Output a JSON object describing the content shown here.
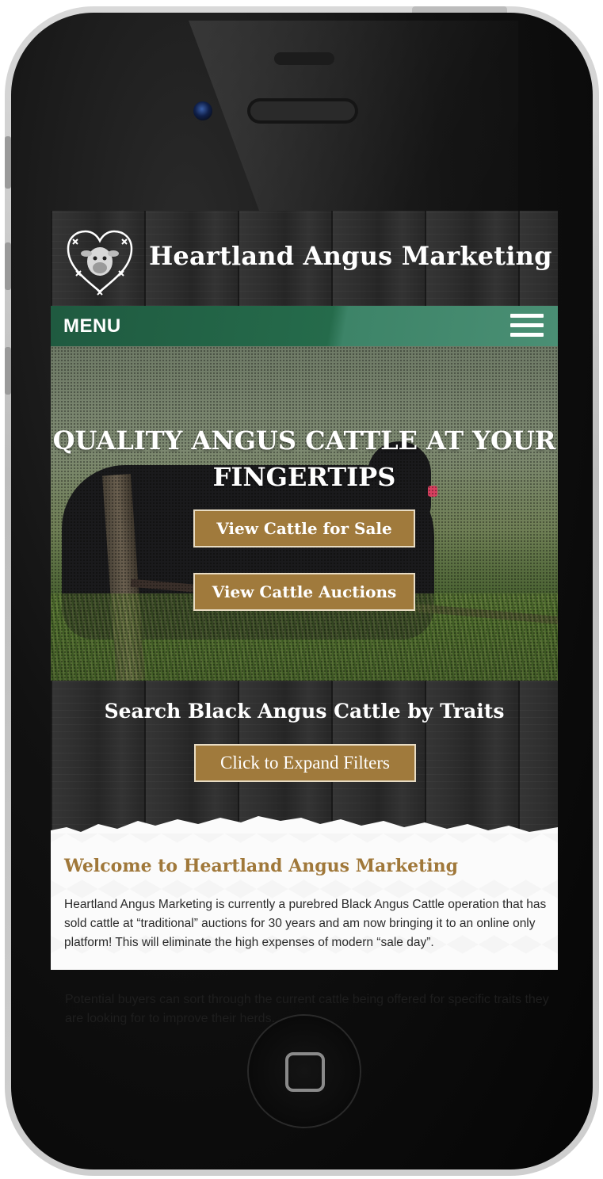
{
  "site": {
    "title": "Heartland Angus Marketing",
    "logo_icon": "heart-barbed-wire-cow-icon"
  },
  "nav": {
    "menu_label": "MENU",
    "menu_icon": "hamburger-icon"
  },
  "hero": {
    "headline": "QUALITY ANGUS CATTLE AT YOUR FINGERTIPS",
    "buttons": [
      {
        "label": "View Cattle for Sale"
      },
      {
        "label": "View Cattle Auctions"
      }
    ]
  },
  "search": {
    "title": "Search Black Angus Cattle by Traits",
    "expand_label": "Click to Expand Filters"
  },
  "welcome": {
    "title": "Welcome to Heartland Angus Marketing",
    "paragraph1": "Heartland Angus Marketing is currently a purebred Black Angus Cattle operation that has sold cattle at “traditional” auctions for 30 years and am now bringing it to an online only platform! This will eliminate the high expenses of modern “sale day”.",
    "paragraph2": "Potential buyers can sort through the current cattle being offered for specific traits they are looking for to improve their herds."
  },
  "colors": {
    "accent_gold": "#a07a3c",
    "nav_green": "#256b4b",
    "title_gold": "#a0783a"
  }
}
